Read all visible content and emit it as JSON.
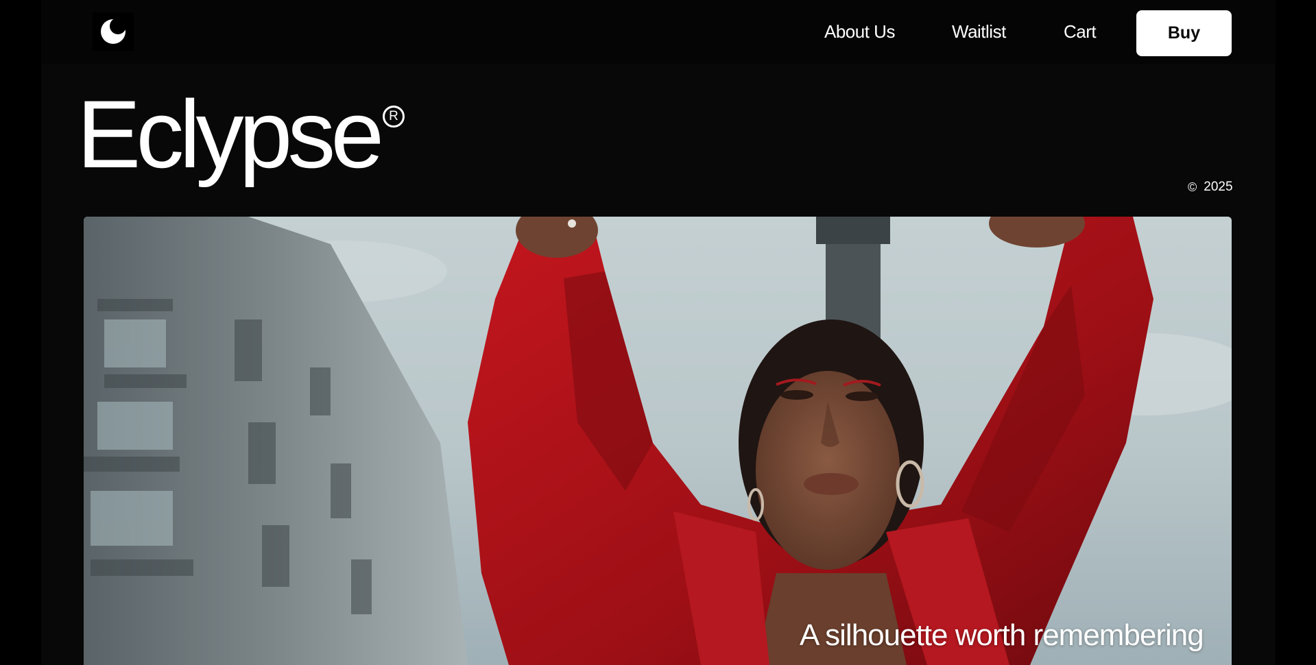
{
  "nav": {
    "logo_icon": "moon-eclipse-icon",
    "links": [
      {
        "label": "About Us"
      },
      {
        "label": "Waitlist"
      },
      {
        "label": "Cart"
      }
    ],
    "buy_label": "Buy"
  },
  "hero": {
    "brand_name": "Eclypse",
    "registered_mark": "R",
    "copyright_symbol": "©",
    "year": "2025",
    "caption": "A silhouette worth remembering"
  },
  "colors": {
    "background": "#080808",
    "nav_background": "#050505",
    "text": "#ffffff",
    "button_background": "#ffffff",
    "button_text": "#0a0a0a",
    "accent_red": "#b3151c"
  }
}
